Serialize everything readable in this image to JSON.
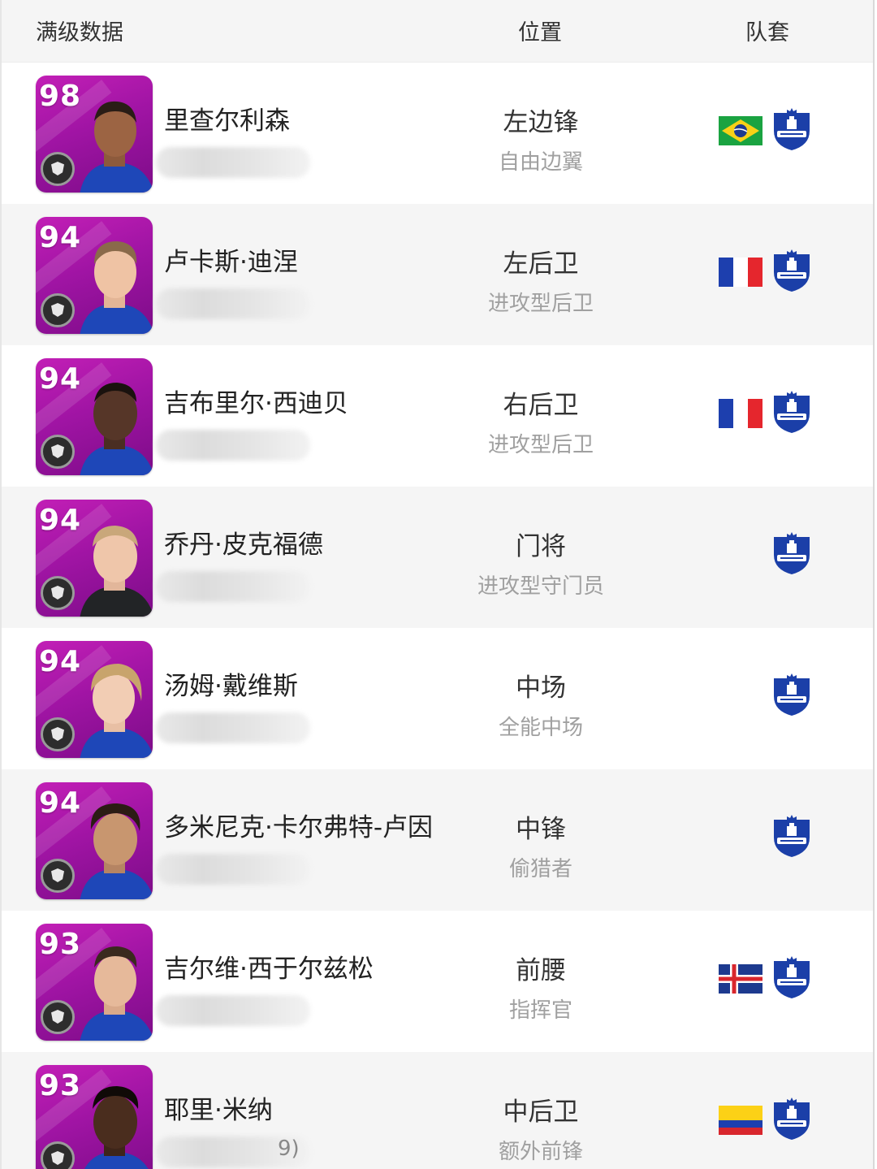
{
  "header": {
    "stats_label": "满级数据",
    "position_label": "位置",
    "kit_label": "队套"
  },
  "rows": [
    {
      "rating": "98",
      "name": "里查尔利森",
      "position": "左边锋",
      "role": "自由边翼",
      "flag": "brazil",
      "club": "everton-crest",
      "blur_tail": ""
    },
    {
      "rating": "94",
      "name": "卢卡斯·迪涅",
      "position": "左后卫",
      "role": "进攻型后卫",
      "flag": "france",
      "club": "everton-crest",
      "blur_tail": ""
    },
    {
      "rating": "94",
      "name": "吉布里尔·西迪贝",
      "position": "右后卫",
      "role": "进攻型后卫",
      "flag": "france",
      "club": "everton-crest",
      "blur_tail": ""
    },
    {
      "rating": "94",
      "name": "乔丹·皮克福德",
      "position": "门将",
      "role": "进攻型守门员",
      "flag": "",
      "club": "everton-crest",
      "blur_tail": ""
    },
    {
      "rating": "94",
      "name": "汤姆·戴维斯",
      "position": "中场",
      "role": "全能中场",
      "flag": "",
      "club": "everton-crest",
      "blur_tail": ""
    },
    {
      "rating": "94",
      "name": "多米尼克·卡尔弗特-卢因",
      "position": "中锋",
      "role": "偷猎者",
      "flag": "",
      "club": "everton-crest",
      "blur_tail": ""
    },
    {
      "rating": "93",
      "name": "吉尔维·西于尔兹松",
      "position": "前腰",
      "role": "指挥官",
      "flag": "iceland",
      "club": "everton-crest",
      "blur_tail": ""
    },
    {
      "rating": "93",
      "name": "耶里·米纳",
      "position": "中后卫",
      "role": "额外前锋",
      "flag": "colombia",
      "club": "everton-crest",
      "blur_tail": "9)"
    }
  ],
  "colors": {
    "card_purple": "#a014a4",
    "everton_blue": "#1b3fa8",
    "alt_row": "#f5f5f5"
  }
}
